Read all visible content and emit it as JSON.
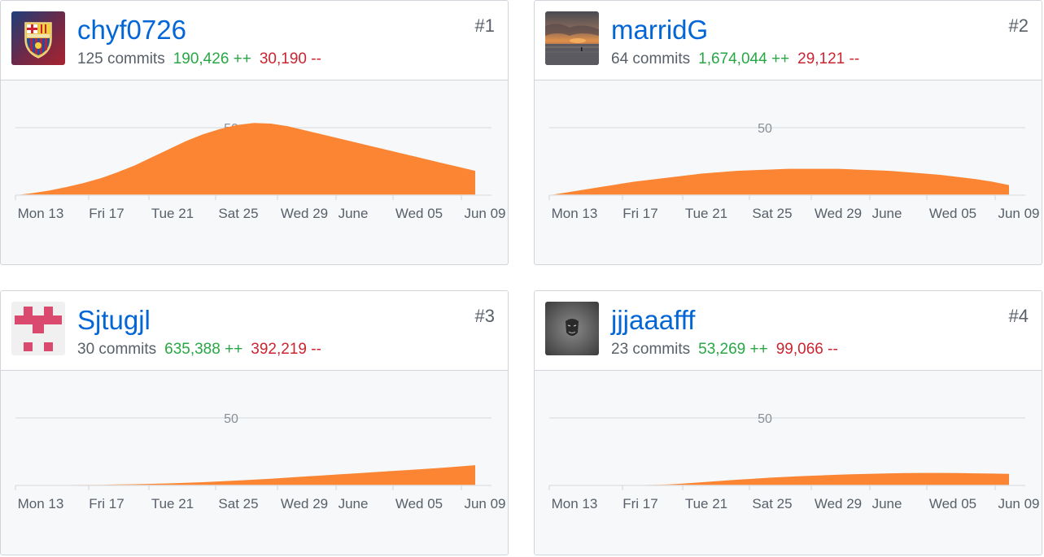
{
  "contributors": [
    {
      "username": "chyf0726",
      "rank": "#1",
      "commits": "125 commits",
      "additions": "190,426 ++",
      "deletions": "30,190 --",
      "avatar": "fc-barcelona-crest-icon",
      "chart_data": {
        "type": "area",
        "color": "#fb8532",
        "x_ticks": [
          "Mon 13",
          "Fri 17",
          "Tue 21",
          "Sat 25",
          "Wed 29",
          "June",
          "Wed 05",
          "Jun 09"
        ],
        "y_gridline": "50",
        "ylim": [
          0,
          60
        ],
        "x": [
          0,
          1,
          2,
          3,
          4,
          5,
          6,
          7,
          8,
          9,
          10,
          11,
          12,
          13,
          14,
          15,
          16,
          17,
          18,
          19,
          20,
          21,
          22,
          23,
          24,
          25,
          26,
          27
        ],
        "values": [
          0,
          1.5,
          3.5,
          6,
          9,
          12.5,
          17,
          22,
          28,
          34,
          40,
          45,
          49,
          52,
          53.5,
          53,
          51,
          48,
          45,
          42,
          39,
          36,
          33,
          30,
          27,
          24,
          21,
          18
        ]
      }
    },
    {
      "username": "marridG",
      "rank": "#2",
      "commits": "64 commits",
      "additions": "1,674,044 ++",
      "deletions": "29,121 --",
      "avatar": "sunset-photo-icon",
      "chart_data": {
        "type": "area",
        "color": "#fb8532",
        "x_ticks": [
          "Mon 13",
          "Fri 17",
          "Tue 21",
          "Sat 25",
          "Wed 29",
          "June",
          "Wed 05",
          "Jun 09"
        ],
        "y_gridline": "50",
        "ylim": [
          0,
          60
        ],
        "x": [
          0,
          1,
          2,
          3,
          4,
          5,
          6,
          7,
          8,
          9,
          10,
          11,
          12,
          13,
          14,
          15,
          16,
          17,
          18,
          19,
          20,
          21,
          22,
          23,
          24,
          25,
          26,
          27
        ],
        "values": [
          0,
          2,
          4,
          6,
          8,
          10,
          11.5,
          13,
          14.5,
          16,
          17,
          18,
          18.5,
          19,
          19.5,
          19.5,
          19.5,
          19.5,
          19,
          18.5,
          18,
          17,
          16,
          15,
          13.5,
          12,
          10,
          7.5
        ]
      }
    },
    {
      "username": "Sjtugjl",
      "rank": "#3",
      "commits": "30 commits",
      "additions": "635,388 ++",
      "deletions": "392,219 --",
      "avatar": "pink-identicon-icon",
      "chart_data": {
        "type": "area",
        "color": "#fb8532",
        "x_ticks": [
          "Mon 13",
          "Fri 17",
          "Tue 21",
          "Sat 25",
          "Wed 29",
          "June",
          "Wed 05",
          "Jun 09"
        ],
        "y_gridline": "50",
        "ylim": [
          0,
          60
        ],
        "x": [
          0,
          1,
          2,
          3,
          4,
          5,
          6,
          7,
          8,
          9,
          10,
          11,
          12,
          13,
          14,
          15,
          16,
          17,
          18,
          19,
          20,
          21,
          22,
          23,
          24,
          25,
          26,
          27
        ],
        "values": [
          0,
          0.1,
          0.2,
          0.3,
          0.4,
          0.5,
          0.7,
          0.9,
          1.2,
          1.5,
          1.9,
          2.4,
          3,
          3.6,
          4.3,
          5,
          5.8,
          6.6,
          7.4,
          8.2,
          9,
          9.8,
          10.6,
          11.4,
          12.2,
          13,
          14,
          15
        ]
      }
    },
    {
      "username": "jjjaaafff",
      "rank": "#4",
      "commits": "23 commits",
      "additions": "53,269 ++",
      "deletions": "99,066 --",
      "avatar": "guy-fawkes-mask-icon",
      "chart_data": {
        "type": "area",
        "color": "#fb8532",
        "x_ticks": [
          "Mon 13",
          "Fri 17",
          "Tue 21",
          "Sat 25",
          "Wed 29",
          "June",
          "Wed 05",
          "Jun 09"
        ],
        "y_gridline": "50",
        "ylim": [
          0,
          60
        ],
        "x": [
          0,
          1,
          2,
          3,
          4,
          5,
          6,
          7,
          8,
          9,
          10,
          11,
          12,
          13,
          14,
          15,
          16,
          17,
          18,
          19,
          20,
          21,
          22,
          23,
          24,
          25,
          26,
          27
        ],
        "values": [
          0,
          0,
          0,
          0,
          0,
          0.1,
          0.4,
          0.8,
          1.5,
          2.4,
          3.3,
          4.2,
          5,
          5.8,
          6.4,
          7,
          7.5,
          8,
          8.4,
          8.7,
          9,
          9.2,
          9.3,
          9.3,
          9.2,
          9,
          8.8,
          8.6
        ]
      }
    }
  ]
}
